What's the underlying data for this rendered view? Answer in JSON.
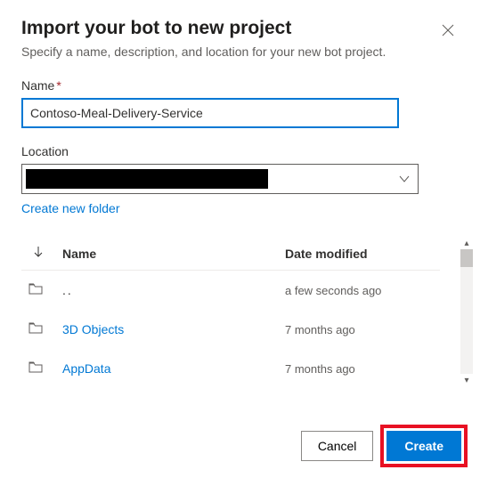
{
  "dialog": {
    "title": "Import your bot to new project",
    "subtitle": "Specify a name, description, and location for your new bot project."
  },
  "fields": {
    "name_label": "Name",
    "name_required_mark": "*",
    "name_value": "Contoso-Meal-Delivery-Service",
    "location_label": "Location",
    "create_folder_link": "Create new folder"
  },
  "table": {
    "headers": {
      "name": "Name",
      "date": "Date modified"
    },
    "rows": [
      {
        "name": "..",
        "date": "a few seconds ago",
        "parent": true
      },
      {
        "name": "3D Objects",
        "date": "7 months ago",
        "parent": false
      },
      {
        "name": "AppData",
        "date": "7 months ago",
        "parent": false
      }
    ]
  },
  "footer": {
    "cancel": "Cancel",
    "create": "Create"
  }
}
